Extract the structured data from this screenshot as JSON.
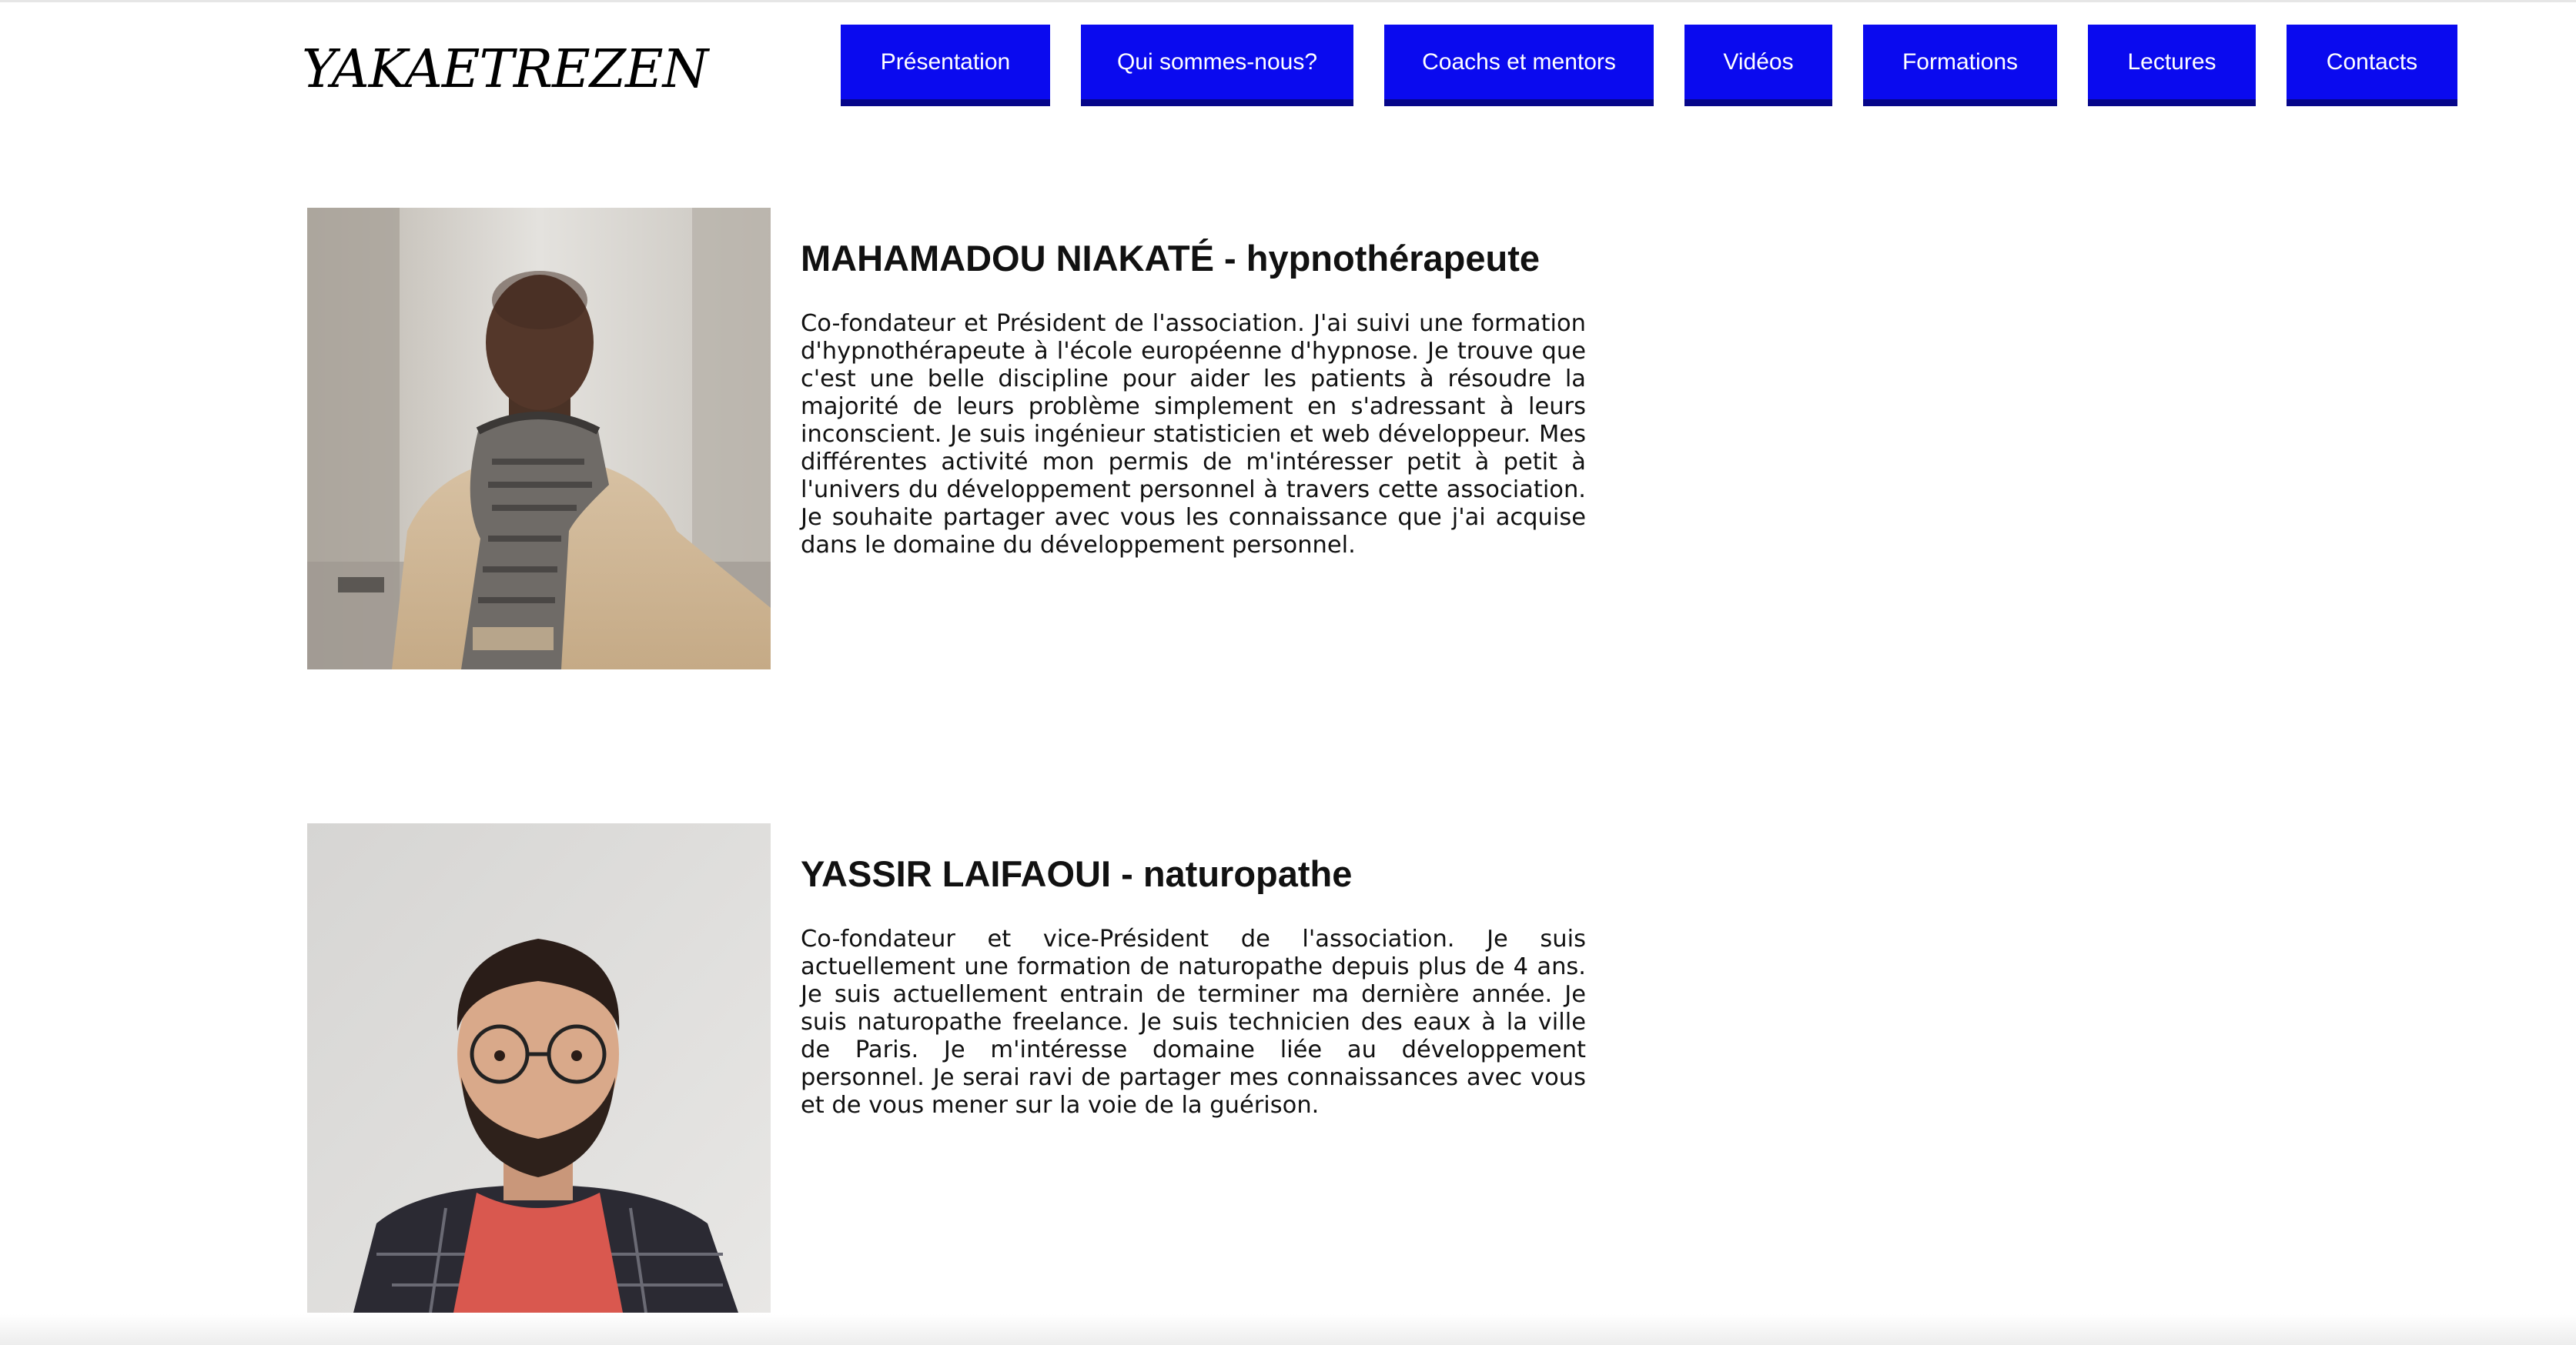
{
  "site": {
    "logo": "YAKAETREZEN"
  },
  "nav": {
    "items": [
      {
        "label": "Présentation"
      },
      {
        "label": "Qui sommes-nous?"
      },
      {
        "label": "Coachs et mentors"
      },
      {
        "label": "Vidéos"
      },
      {
        "label": "Formations"
      },
      {
        "label": "Lectures"
      },
      {
        "label": "Contacts"
      }
    ]
  },
  "colors": {
    "nav_button": "#0a0aef",
    "nav_button_shadow": "#06068a",
    "text": "#111111",
    "background": "#ffffff"
  },
  "profiles": [
    {
      "title": "MAHAMADOU NIAKATÉ - hypnothérapeute",
      "text": "Co-fondateur et Président de l'association. J'ai suivi une formation d'hypnothérapeute à l'école européenne d'hypnose. Je trouve que c'est une belle discipline pour aider les patients à résoudre la majorité de leurs problème simplement en s'adressant à leurs inconscient. Je suis ingénieur statisticien et web développeur. Mes différentes activité mon permis de m'intéresser petit à petit à l'univers du développement personnel à travers cette association. Je souhaite partager avec vous les connaissance que j'ai acquise dans le domaine du développement personnel.",
      "photo_icon": "person-photo-scarf"
    },
    {
      "title": "YASSIR LAIFAOUI - naturopathe",
      "text": "Co-fondateur et vice-Président de l'association. Je suis actuellement une formation de naturopathe depuis plus de 4 ans. Je suis actuellement entrain de terminer ma dernière année. Je suis naturopathe freelance. Je suis technicien des eaux à la ville de Paris. Je m'intéresse domaine liée au développement personnel. Je serai ravi de partager mes connaissances avec vous et de vous mener sur la voie de la guérison.",
      "photo_icon": "person-photo-glasses"
    }
  ]
}
